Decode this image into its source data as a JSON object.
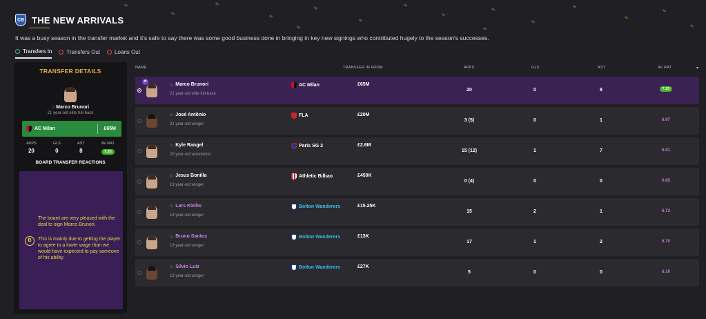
{
  "header": {
    "title": "THE NEW ARRIVALS",
    "crest_text": "CB"
  },
  "description": "It was a busy season in the transfer market and it's safe to say there was some good business done in bringing in key new signings who contributed hugely to the season's successes.",
  "tabs": [
    {
      "label": "Transfers In",
      "active": true
    },
    {
      "label": "Transfers Out",
      "active": false
    },
    {
      "label": "Loans Out",
      "active": false
    }
  ],
  "details": {
    "title": "TRANSFER DETAILS",
    "player_name": "Marco Brunori",
    "player_sub": "21 year-old elite full-back",
    "club": "AC Milan",
    "fee": "£65M",
    "stat_labels": [
      "APPS",
      "GLS",
      "AST",
      "AV RAT"
    ],
    "stat_values": [
      "20",
      "0",
      "8",
      "7.25"
    ],
    "reactions_title": "BOARD TRANSFER REACTIONS",
    "reaction_1": "The board are very pleased with the deal to sign Marco Brunori.",
    "reaction_2": "This is mainly due to getting the player to agree to a lower wage than we would have expected to pay someone of his ability.",
    "badge": "B"
  },
  "columns": {
    "name": "NAME",
    "from": "TRANSFER IN FROM",
    "apps": "APPS",
    "gls": "GLS",
    "ast": "AST",
    "rat": "AV RAT"
  },
  "rows": [
    {
      "name": "Marco Brunori",
      "sub": "21 year-old elite full-back",
      "club": "AC Milan",
      "fee": "£65M",
      "apps": "20",
      "gls": "0",
      "ast": "8",
      "rat": "7.25"
    },
    {
      "name": "José Antônio",
      "sub": "21 year-old winger",
      "club": "FLA",
      "fee": "£20M",
      "apps": "3 (5)",
      "gls": "0",
      "ast": "1",
      "rat": "6.97"
    },
    {
      "name": "Kyle Rangel",
      "sub": "20 year-old wonderkid",
      "club": "Paris SG 2",
      "fee": "£2.6M",
      "apps": "15 (12)",
      "gls": "1",
      "ast": "7",
      "rat": "6.91"
    },
    {
      "name": "Jesus Bonilla",
      "sub": "19 year-old winger",
      "club": "Athletic Bilbao",
      "fee": "£450K",
      "apps": "0 (4)",
      "gls": "0",
      "ast": "0",
      "rat": "6.85"
    },
    {
      "name": "Lars Kleihs",
      "sub": "18 year-old winger",
      "club": "Bolton Wanderers",
      "fee": "£15.25K",
      "apps": "15",
      "gls": "2",
      "ast": "1",
      "rat": "6.72"
    },
    {
      "name": "Bruno Santos",
      "sub": "19 year-old winger",
      "club": "Bolton Wanderers",
      "fee": "£13K",
      "apps": "17",
      "gls": "1",
      "ast": "2",
      "rat": "6.70"
    },
    {
      "name": "Silvio Luiz",
      "sub": "18 year-old winger",
      "club": "Bolton Wanderers",
      "fee": "£27K",
      "apps": "5",
      "gls": "0",
      "ast": "0",
      "rat": "6.10"
    }
  ],
  "icons": {
    "lock": "lock-icon",
    "star": "star-icon",
    "sort": "chevron-down-icon"
  },
  "colors": {
    "accent": "#e3b340",
    "selected_row": "#3a2253",
    "club_bar": "#2a8a3e",
    "rating": "#c67ae0",
    "reaction_text": "#e8d84a"
  }
}
